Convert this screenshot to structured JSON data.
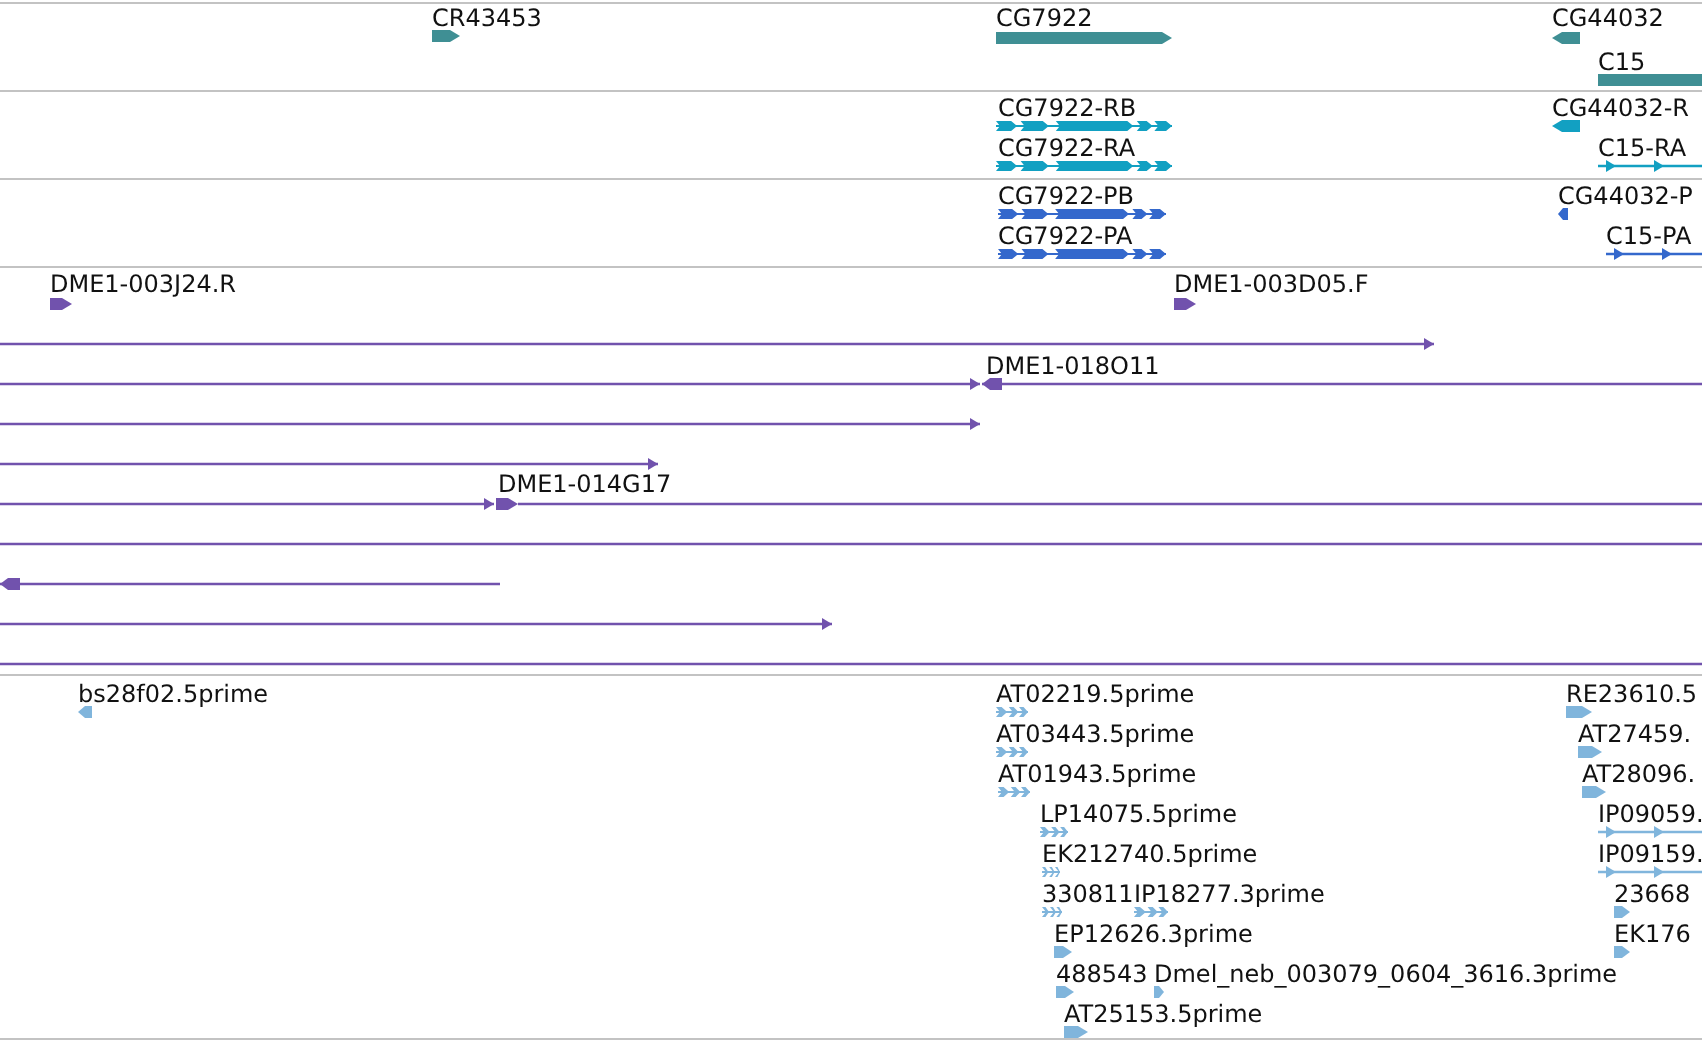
{
  "tracks": [
    {
      "color": "#3f8f94",
      "features": [
        {
          "label": "CR43453",
          "kind": "block",
          "reverse": false,
          "open_ended": false
        },
        {
          "label": "CG7922",
          "kind": "block",
          "reverse": false,
          "open_ended": false
        },
        {
          "label": "CG44032",
          "kind": "block",
          "reverse": true,
          "open_ended": false
        },
        {
          "label": "C15",
          "kind": "block",
          "open_ended": true
        }
      ]
    },
    {
      "color": "#12a0c2",
      "features": [
        {
          "label": "CG7922-RB",
          "kind": "exons",
          "reverse": false,
          "open_ended": false
        },
        {
          "label": "CG7922-RA",
          "kind": "exons",
          "reverse": false,
          "open_ended": false
        },
        {
          "label": "CG44032-R",
          "kind": "block",
          "reverse": true,
          "open_ended": false
        },
        {
          "label": "C15-RA",
          "kind": "line",
          "reverse": false,
          "open_ended": false
        }
      ]
    },
    {
      "color": "#3468cc",
      "features": [
        {
          "label": "CG7922-PB",
          "kind": "exons",
          "reverse": false,
          "open_ended": false
        },
        {
          "label": "CG7922-PA",
          "kind": "exons",
          "reverse": false,
          "open_ended": false
        },
        {
          "label": "CG44032-P",
          "kind": "block",
          "reverse": true,
          "open_ended": false
        },
        {
          "label": "C15-PA",
          "kind": "line",
          "reverse": false,
          "open_ended": false
        }
      ]
    },
    {
      "color": "#7152ad",
      "features": [
        {
          "label": "DME1-003J24.R",
          "kind": "block",
          "reverse": false,
          "open_ended": false
        },
        {
          "label": "DME1-003D05.F",
          "kind": "block",
          "reverse": false,
          "open_ended": false
        },
        {
          "kind": "span",
          "reverse": false,
          "open_ended": false
        },
        {
          "kind": "span",
          "reverse": false,
          "open_ended": false
        },
        {
          "label": "DME1-018O11",
          "kind": "span",
          "reverse": true,
          "open_ended": false
        },
        {
          "kind": "span",
          "reverse": false,
          "open_ended": false
        },
        {
          "kind": "span",
          "reverse": false,
          "open_ended": false
        },
        {
          "kind": "span",
          "reverse": false,
          "open_ended": false
        },
        {
          "label": "DME1-014G17",
          "kind": "block",
          "reverse": false,
          "open_ended": false
        },
        {
          "kind": "span",
          "open_ended": true
        },
        {
          "kind": "span",
          "open_ended": true
        },
        {
          "kind": "span",
          "reverse": true,
          "open_ended": false
        },
        {
          "kind": "span",
          "reverse": false,
          "open_ended": false
        },
        {
          "kind": "span",
          "open_ended": true
        }
      ]
    },
    {
      "color": "#80b5dc",
      "features": [
        {
          "label": "bs28f02.5prime",
          "kind": "block",
          "reverse": true,
          "open_ended": false
        },
        {
          "label": "AT02219.5prime",
          "kind": "exons",
          "reverse": false,
          "open_ended": false
        },
        {
          "label": "AT03443.5prime",
          "kind": "exons",
          "reverse": false,
          "open_ended": false
        },
        {
          "label": "AT01943.5prime",
          "kind": "exons",
          "reverse": false,
          "open_ended": false
        },
        {
          "label": "LP14075.5prime",
          "kind": "exons",
          "reverse": false,
          "open_ended": false
        },
        {
          "label": "EK212740.5prime",
          "kind": "exons",
          "reverse": false,
          "open_ended": false
        },
        {
          "label": "330811",
          "kind": "exons",
          "reverse": false,
          "open_ended": false
        },
        {
          "label": "IP18277.3prime",
          "kind": "exons",
          "reverse": false,
          "open_ended": false
        },
        {
          "label": "EP12626.3prime",
          "kind": "block",
          "reverse": false,
          "open_ended": false
        },
        {
          "label": "488543",
          "kind": "block",
          "reverse": false,
          "open_ended": false
        },
        {
          "label": "Dmel_neb_003079_0604_3616.3prime",
          "kind": "block",
          "reverse": false,
          "open_ended": false
        },
        {
          "label": "AT25153.5prime",
          "kind": "block",
          "reverse": false,
          "open_ended": false
        },
        {
          "label": "RE23610.5",
          "kind": "block",
          "reverse": false,
          "open_ended": false
        },
        {
          "label": "AT27459.",
          "kind": "block",
          "reverse": false,
          "open_ended": false
        },
        {
          "label": "AT28096.",
          "kind": "block",
          "reverse": false,
          "open_ended": false
        },
        {
          "label": "IP09059.",
          "kind": "line",
          "reverse": false,
          "open_ended": false
        },
        {
          "label": "IP09159.",
          "kind": "line",
          "reverse": false,
          "open_ended": false
        },
        {
          "label": "23668",
          "kind": "block",
          "reverse": false,
          "open_ended": false
        },
        {
          "label": "EK176",
          "kind": "block",
          "reverse": false,
          "open_ended": false
        }
      ]
    }
  ]
}
